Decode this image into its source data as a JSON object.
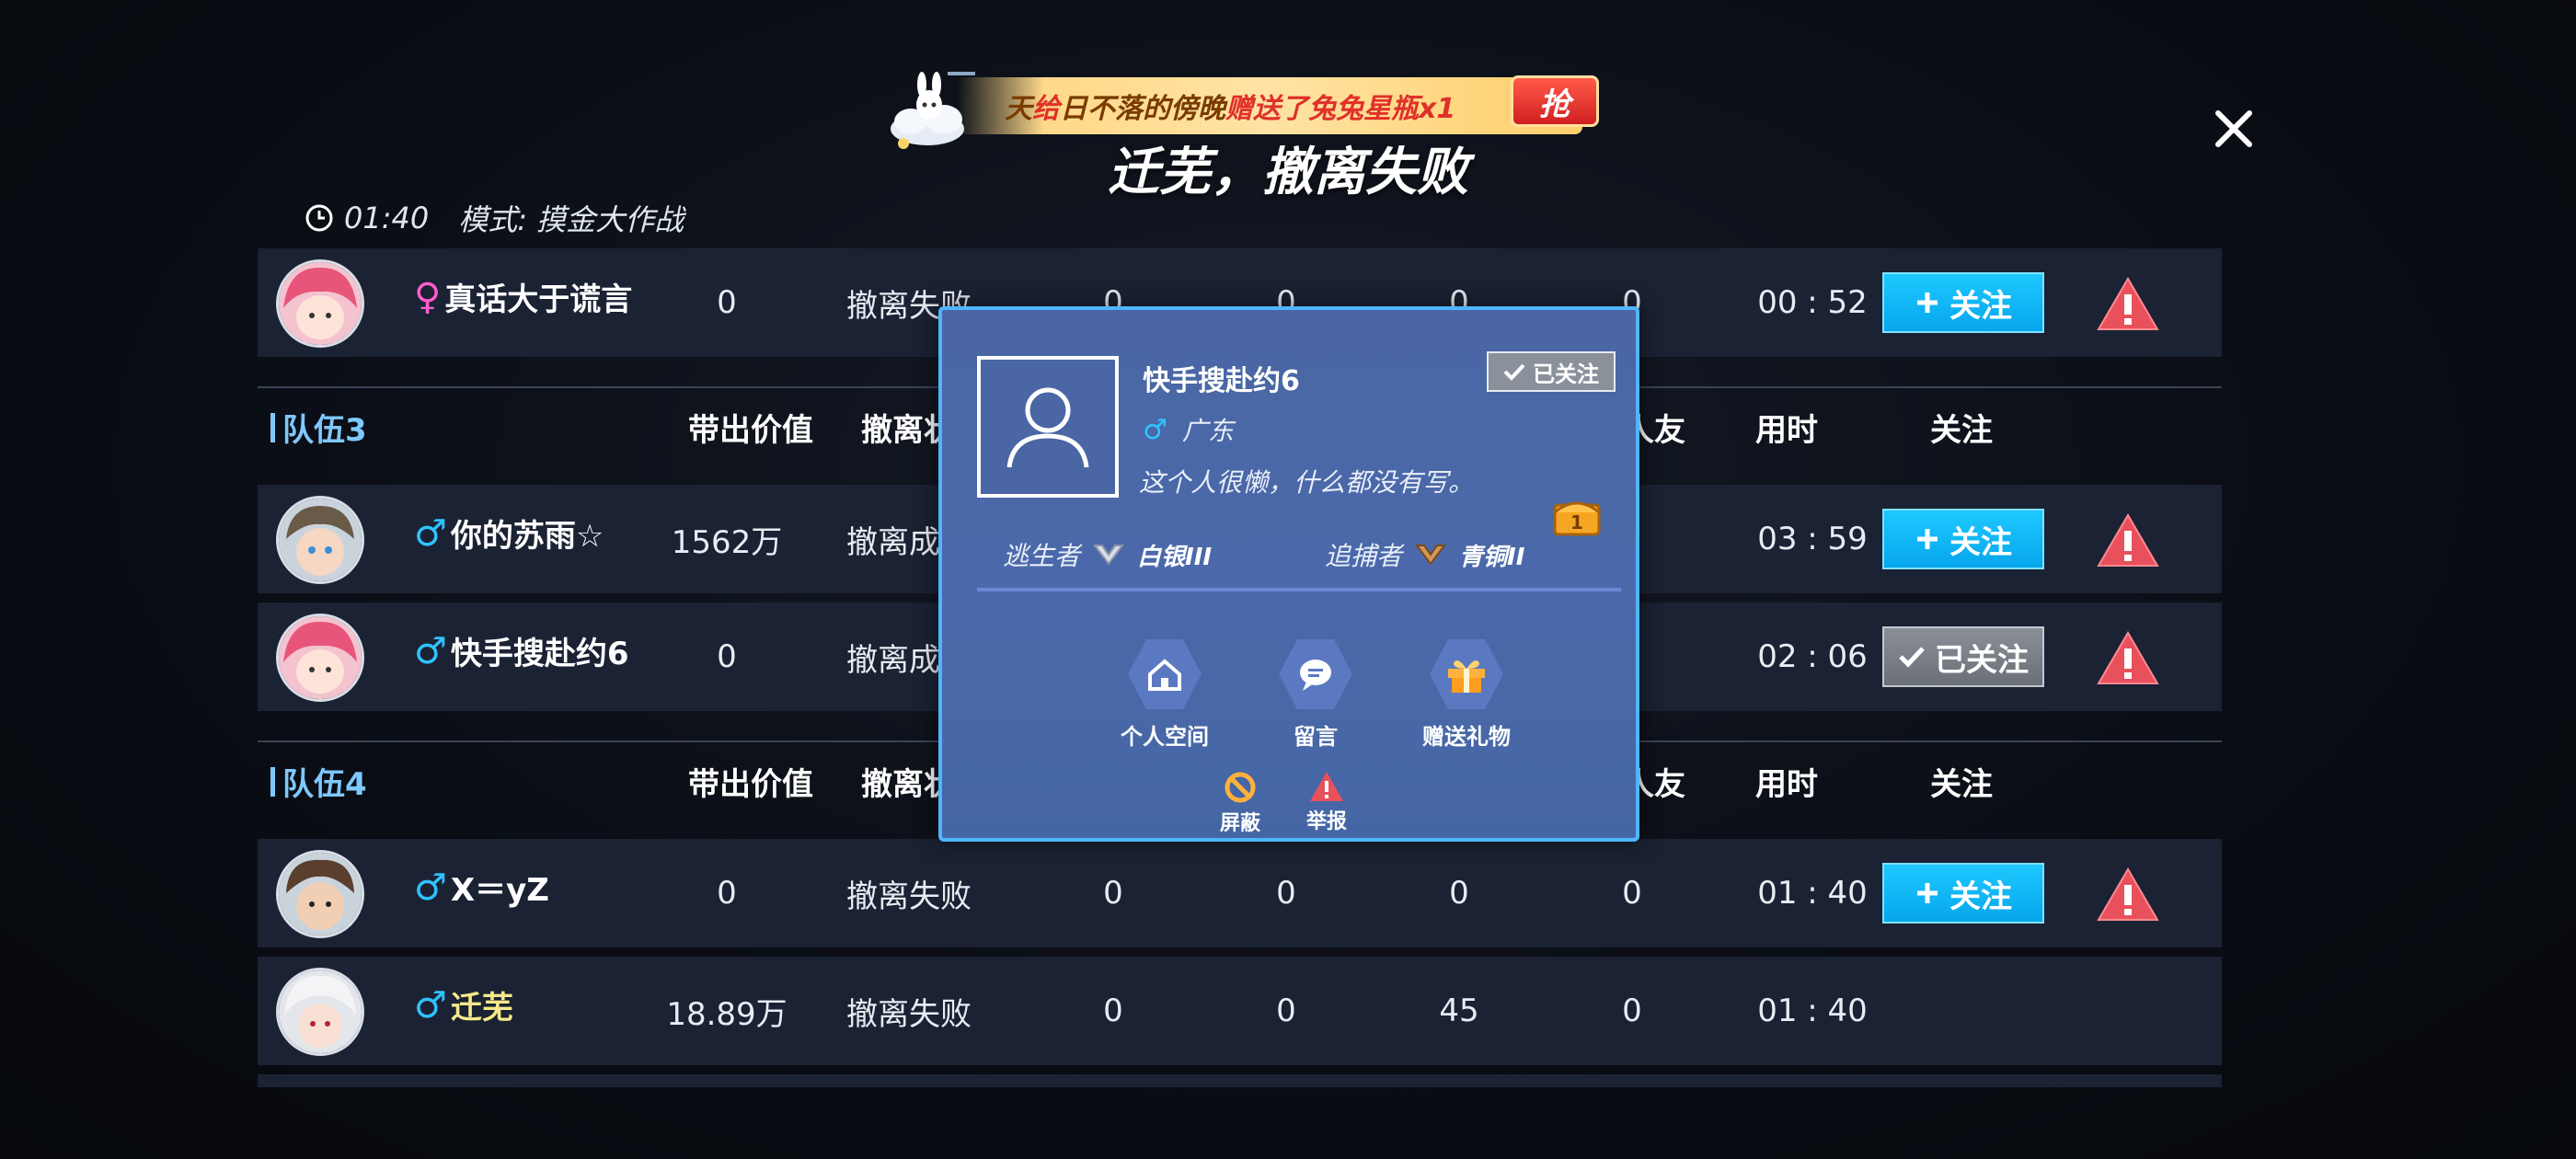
{
  "banner": {
    "segments": [
      {
        "text": "天 ",
        "style": "w1"
      },
      {
        "text": "给 ",
        "style": "w2"
      },
      {
        "text": "日不落的傍晚 ",
        "style": "w1"
      },
      {
        "text": "赠送了 ",
        "style": "w2"
      },
      {
        "text": "兔兔星瓶x1",
        "style": "w2"
      }
    ],
    "grab_label": "抢"
  },
  "title": "迁芜，撤离失败",
  "meta": {
    "time": "01:40",
    "mode": "模式: 摸金大作战"
  },
  "rows_top": [
    {
      "name": "真话大于谎言",
      "gender": "♀",
      "value": "0",
      "status": "撤离失败",
      "a": "0",
      "b": "0",
      "c": "0",
      "d": "0",
      "time": "00 : 52",
      "follow": "关注",
      "followed": false
    }
  ],
  "teams": [
    {
      "label": "队伍3",
      "headers": {
        "value": "带出价值",
        "status": "撤离状",
        "friends": "人友",
        "time": "用时",
        "follow": "关注"
      },
      "rows": [
        {
          "name": "你的苏雨☆",
          "gender": "♂",
          "value": "1562万",
          "status": "撤离成",
          "time": "03 : 59",
          "follow": "关注",
          "followed": false
        },
        {
          "name": "快手搜赴约6",
          "gender": "♂",
          "value": "0",
          "status": "撤离成",
          "time": "02 : 06",
          "follow": "已关注",
          "followed": true
        }
      ]
    },
    {
      "label": "队伍4",
      "headers": {
        "value": "带出价值",
        "status": "撤离状",
        "friends": "人友",
        "time": "用时",
        "follow": "关注"
      },
      "rows": [
        {
          "name": "X＝yZ",
          "gender": "♂",
          "value": "0",
          "status": "撤离失败",
          "a": "0",
          "b": "0",
          "c": "0",
          "d": "0",
          "time": "01 : 40",
          "follow": "关注",
          "followed": false
        },
        {
          "name": "迁芜",
          "gender": "♂",
          "value": "18.89万",
          "status": "撤离失败",
          "a": "0",
          "b": "0",
          "c": "45",
          "d": "0",
          "time": "01 : 40",
          "follow": "",
          "followed": false,
          "me": true
        }
      ]
    }
  ],
  "popup": {
    "name": "快手搜赴约6",
    "followed_label": "已关注",
    "gender": "♂",
    "location": "广东",
    "bio": "这个人很懒，什么都没有写。",
    "chest_level": "1",
    "escaper_label": "逃生者",
    "escaper_rank": "白银III",
    "hunter_label": "追捕者",
    "hunter_rank": "青铜II",
    "actions": {
      "space": "个人空间",
      "message": "留言",
      "gift": "赠送礼物",
      "block": "屏蔽",
      "report": "举报"
    }
  },
  "colors": {
    "accent": "#1ec8ff",
    "row_bg": "#1a2233",
    "popup_bg": "#4a66a4",
    "popup_border": "#4fb5ff",
    "warning": "#e8505b"
  }
}
